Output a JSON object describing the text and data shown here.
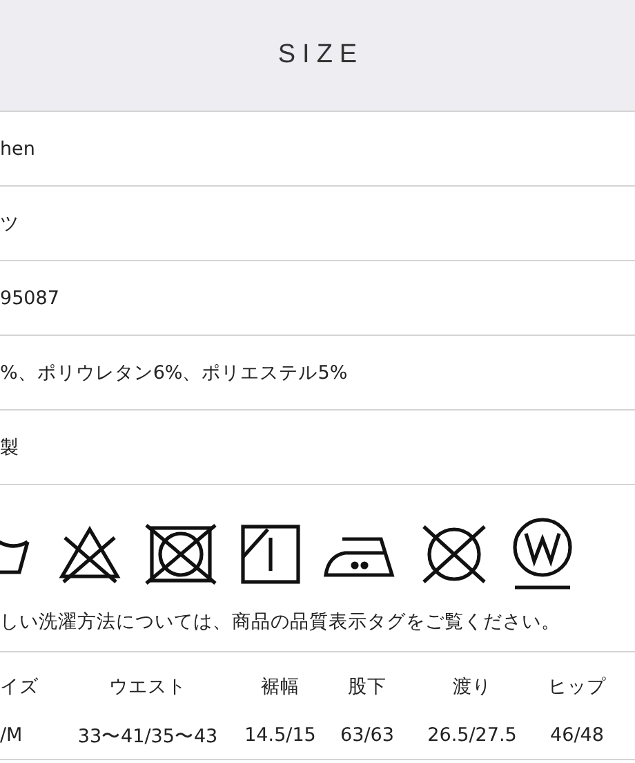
{
  "header": {
    "title": "SIZE"
  },
  "info_rows": [
    "hen",
    "ツ",
    "95087",
    "%、ポリウレタン6%、ポリエステル5%",
    "製"
  ],
  "care_note": "しい洗濯方法については、商品の品質表示タグをご覧ください。",
  "size_table": {
    "columns": [
      "イズ",
      "ウエスト",
      "裾幅",
      "股下",
      "渡り",
      "ヒップ"
    ],
    "rows": [
      [
        "/M",
        "33〜41/35〜43",
        "14.5/15",
        "63/63",
        "26.5/27.5",
        "46/48"
      ]
    ]
  }
}
